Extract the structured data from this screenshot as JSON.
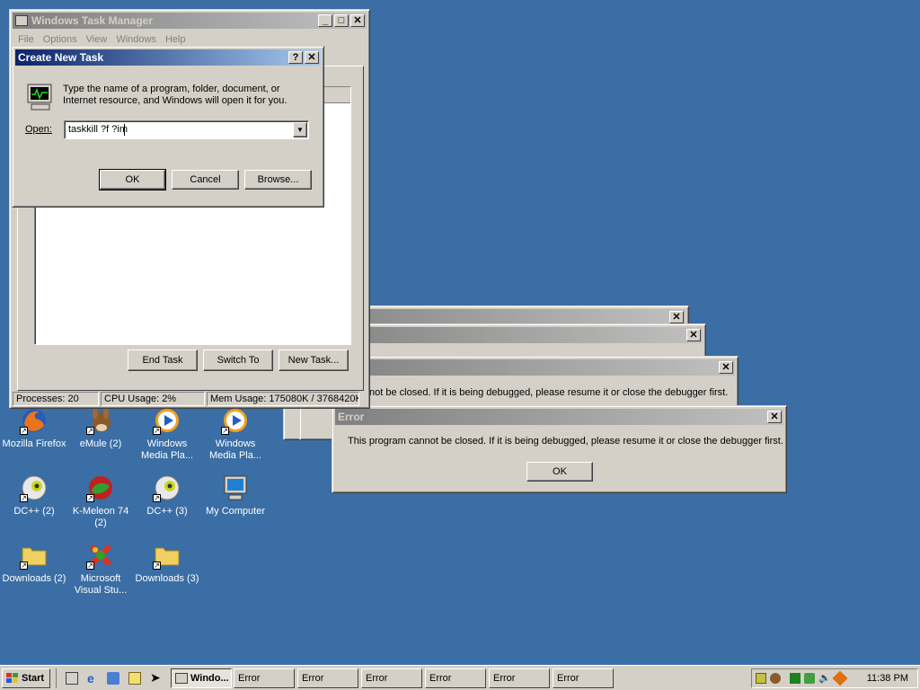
{
  "colors": {
    "desktop": "#3a6ea5",
    "title_active": "#0a246a",
    "title_inactive": "#808080"
  },
  "desktop_icons": [
    {
      "label": "Mozilla Firefox",
      "icon": "firefox-icon"
    },
    {
      "label": "eMule (2)",
      "icon": "emule-icon"
    },
    {
      "label": "Windows Media Pla...",
      "icon": "media-player-icon"
    },
    {
      "label": "Windows Media Pla...",
      "icon": "media-player-icon"
    },
    {
      "label": "DC++ (2)",
      "icon": "dcpp-icon"
    },
    {
      "label": "K-Meleon 74 (2)",
      "icon": "kmeleon-icon"
    },
    {
      "label": "DC++ (3)",
      "icon": "dcpp-icon"
    },
    {
      "label": "My Computer",
      "icon": "my-computer-icon"
    },
    {
      "label": "Downloads (2)",
      "icon": "folder-icon"
    },
    {
      "label": "Microsoft Visual Stu...",
      "icon": "visual-studio-icon"
    },
    {
      "label": "Downloads (3)",
      "icon": "folder-icon"
    }
  ],
  "task_manager": {
    "title": "Windows Task Manager",
    "menu": [
      "File",
      "Options",
      "View",
      "Windows",
      "Help"
    ],
    "buttons": {
      "end_task": "End Task",
      "switch_to": "Switch To",
      "new_task": "New Task..."
    },
    "status": {
      "processes": "Processes: 20",
      "cpu": "CPU Usage: 2%",
      "mem": "Mem Usage: 175080K / 3768420K"
    }
  },
  "create_task": {
    "title": "Create New Task",
    "description": "Type the name of a program, folder, document, or Internet resource, and Windows will open it for you.",
    "open_label": "Open:",
    "open_value": "taskkill ?f ?im",
    "ok": "OK",
    "cancel": "Cancel",
    "browse": "Browse..."
  },
  "errors": {
    "title": "Error",
    "message": "This program cannot be closed. If it is being debugged, please resume it or close the debugger first.",
    "partial_message": "not be closed. If it is being debugged, please resume it or close the debugger first.",
    "ok": "OK"
  },
  "taskbar": {
    "start": "Start",
    "tasks": [
      "Windo...",
      "Error",
      "Error",
      "Error",
      "Error",
      "Error",
      "Error"
    ],
    "clock": "11:38 PM"
  }
}
